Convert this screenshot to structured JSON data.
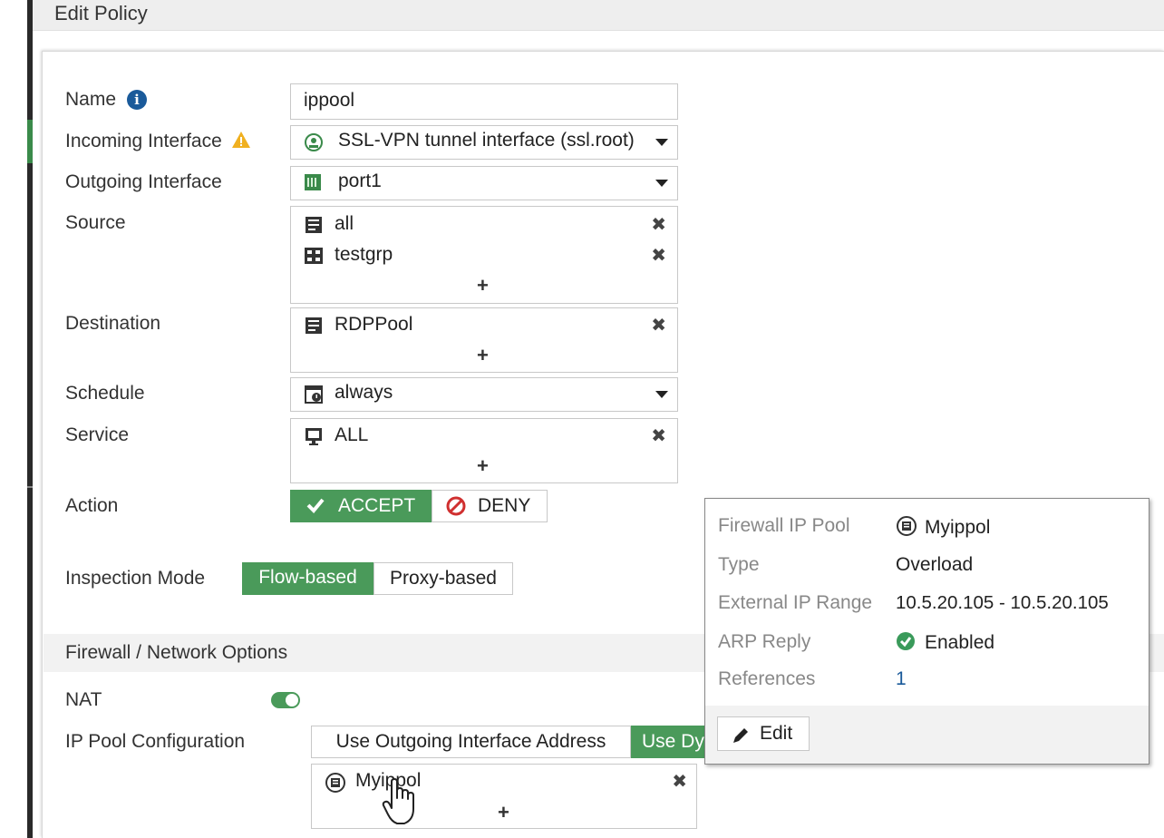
{
  "header": {
    "title": "Edit Policy"
  },
  "form": {
    "name": {
      "label": "Name",
      "value": "ippool"
    },
    "incoming": {
      "label": "Incoming Interface",
      "value": "SSL-VPN tunnel interface (ssl.root)"
    },
    "outgoing": {
      "label": "Outgoing Interface",
      "value": "port1"
    },
    "source": {
      "label": "Source",
      "items": [
        "all",
        "testgrp"
      ]
    },
    "destination": {
      "label": "Destination",
      "items": [
        "RDPPool"
      ]
    },
    "schedule": {
      "label": "Schedule",
      "value": "always"
    },
    "service": {
      "label": "Service",
      "items": [
        "ALL"
      ]
    },
    "action": {
      "label": "Action",
      "accept": "ACCEPT",
      "deny": "DENY",
      "selected": "ACCEPT"
    },
    "inspection": {
      "label": "Inspection Mode",
      "flow": "Flow-based",
      "proxy": "Proxy-based",
      "selected": "Flow-based"
    }
  },
  "firewall_section": {
    "title": "Firewall / Network Options",
    "nat": {
      "label": "NAT",
      "enabled": true
    },
    "ippool_config": {
      "label": "IP Pool Configuration",
      "outgoing_option": "Use Outgoing Interface Address",
      "dynamic_option": "Use Dy",
      "selected": "Use Dy",
      "pools": [
        "Myippol"
      ]
    }
  },
  "tooltip": {
    "pool_key": "Firewall IP Pool",
    "pool_val": "Myippol",
    "type_key": "Type",
    "type_val": "Overload",
    "range_key": "External IP Range",
    "range_val": "10.5.20.105 - 10.5.20.105",
    "arp_key": "ARP Reply",
    "arp_val": "Enabled",
    "refs_key": "References",
    "refs_val": "1",
    "edit_label": "Edit"
  },
  "colors": {
    "accent": "#4a9a5a",
    "link": "#1a5a9a",
    "warning": "#f0b020"
  }
}
